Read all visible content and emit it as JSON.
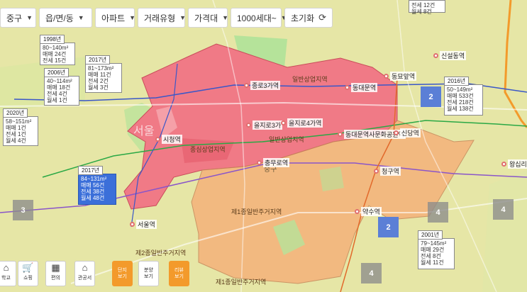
{
  "filters": [
    {
      "label": "중구",
      "icon": "caret-down-icon"
    },
    {
      "label": "읍/면/동",
      "icon": "caret-down-icon"
    },
    {
      "label": "아파트",
      "icon": "caret-down-icon"
    },
    {
      "label": "거래유형",
      "icon": "caret-down-icon"
    },
    {
      "label": "가격대",
      "icon": "caret-down-icon"
    },
    {
      "label": "1000세대~",
      "icon": "caret-down-icon"
    },
    {
      "label": "초기화",
      "icon": "refresh-icon"
    }
  ],
  "listings": [
    {
      "year": "1998년",
      "lines": [
        "80~140m²",
        "매매 24건",
        "전세 15건"
      ],
      "selected": false
    },
    {
      "year": "2006년",
      "lines": [
        "40~114m²",
        "매매 18건",
        "전세 4건",
        "월세 1건"
      ],
      "selected": false
    },
    {
      "year": "2017년",
      "lines": [
        "81~173m²",
        "매매 11건",
        "전세 2건",
        "월세 3건"
      ],
      "selected": false
    },
    {
      "year": "2020년",
      "lines": [
        "58~151m²",
        "매매 1건",
        "전세 1건",
        "월세 4건"
      ],
      "selected": false
    },
    {
      "year": "2017년",
      "lines": [
        "84~131m²",
        "매매 56건",
        "전세 38건",
        "월세 48건"
      ],
      "selected": true
    },
    {
      "year": "2016년",
      "lines": [
        "50~149m²",
        "매매 533건",
        "전세 218건",
        "월세 138건"
      ],
      "selected": false
    },
    {
      "year": "2001년",
      "lines": [
        "79~145m²",
        "매매 29건",
        "전세 8건",
        "월세 11건"
      ],
      "selected": false
    },
    {
      "year": "",
      "lines": [
        "전세 12건",
        "월세 8건"
      ],
      "selected": false
    }
  ],
  "clusters": [
    {
      "count": "3",
      "style": "grey"
    },
    {
      "count": "2",
      "style": "blue"
    },
    {
      "count": "2",
      "style": "blue"
    },
    {
      "count": "4",
      "style": "grey"
    },
    {
      "count": "4",
      "style": "grey"
    },
    {
      "count": "4",
      "style": "grey"
    }
  ],
  "stations": [
    "종로3가역",
    "동대문역",
    "동묘앞역",
    "신설동역",
    "을지로3가",
    "을지로4가역",
    "동대문역사문화공원역",
    "신당역",
    "시청역",
    "충무로역",
    "청구역",
    "약수역",
    "서울역",
    "왕십리역"
  ],
  "zones": [
    "일반상업지역",
    "일반상업지역",
    "종심상업지역",
    "제1종일반주거지역",
    "제2종일반주거지역",
    "제1종일반주거지역"
  ],
  "map_text": [
    "중구",
    "서울"
  ],
  "tools": [
    {
      "label": "학교",
      "icon": "school-icon"
    },
    {
      "label": "쇼핑",
      "icon": "cart-icon"
    },
    {
      "label": "편의",
      "icon": "store-icon"
    },
    {
      "label": "관공서",
      "icon": "government-icon"
    }
  ],
  "view_buttons": [
    {
      "label": "단지\n보기",
      "active": true
    },
    {
      "label": "분양\n보기",
      "active": false
    },
    {
      "label": "리뷰\n보기",
      "active": true
    }
  ],
  "colors": {
    "base": "#e6e6a6",
    "commercial": "#f07a86",
    "residential": "#f5b27a",
    "accent": "#f39a2b",
    "selected": "#3b6fd9"
  }
}
